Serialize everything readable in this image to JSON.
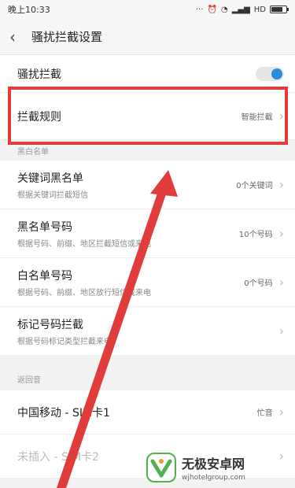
{
  "status": {
    "time": "晚上10:33",
    "network": "HD"
  },
  "header": {
    "title": "骚扰拦截设置"
  },
  "rows": {
    "harass": {
      "label": "骚扰拦截"
    },
    "rule": {
      "label": "拦截规则",
      "value": "智能拦截"
    }
  },
  "blacklist_section": {
    "label": "黑白名单",
    "items": [
      {
        "label": "关键词黑名单",
        "sub": "根据关键词拦截短信",
        "value": "0个关键词"
      },
      {
        "label": "黑名单号码",
        "sub": "根据号码、前缀、地区拦截短信或来电",
        "value": "10个号码"
      },
      {
        "label": "白名单号码",
        "sub": "根据号码、前缀、地区放行短信或来电",
        "value": "0个号码"
      },
      {
        "label": "标记号码拦截",
        "sub": "根据号码标记类型拦截来电",
        "value": ""
      }
    ]
  },
  "tone_section": {
    "label": "返回音",
    "items": [
      {
        "label": "中国移动 - SIM卡1",
        "value": "忙音"
      },
      {
        "label": "未插入 - SIM卡2",
        "value": ""
      }
    ]
  },
  "watermark": {
    "title": "无极安卓网",
    "url": "wjhotelgroup.com"
  },
  "colors": {
    "highlight": "#e03c3c",
    "toggle_on": "#2f8bd8"
  }
}
